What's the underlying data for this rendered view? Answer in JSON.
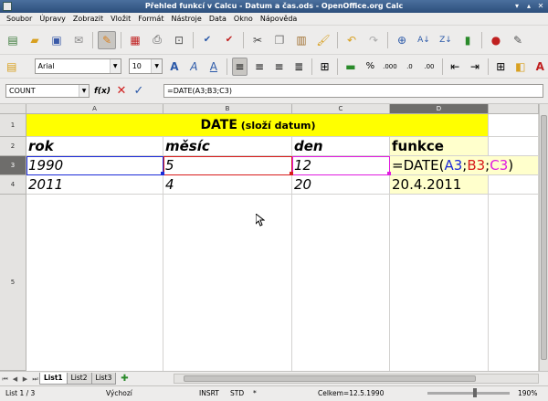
{
  "window": {
    "title": "Přehled funkcí v Calcu - Datum a čas.ods - OpenOffice.org Calc",
    "minimize": "▾",
    "maximize": "▴",
    "close": "✕"
  },
  "menu": [
    "Soubor",
    "Úpravy",
    "Zobrazit",
    "Vložit",
    "Formát",
    "Nástroje",
    "Data",
    "Okno",
    "Nápověda"
  ],
  "toolbar": {
    "font_name": "Arial",
    "font_size": "10"
  },
  "formula_bar": {
    "name_box": "COUNT",
    "fx_label": "f(x)",
    "formula": "=DATE(A3;B3;C3)"
  },
  "columns": [
    {
      "label": "A",
      "selected": false
    },
    {
      "label": "B",
      "selected": false
    },
    {
      "label": "C",
      "selected": false
    },
    {
      "label": "D",
      "selected": true
    }
  ],
  "rows": [
    {
      "label": "1",
      "selected": false
    },
    {
      "label": "2",
      "selected": false
    },
    {
      "label": "3",
      "selected": true
    },
    {
      "label": "4",
      "selected": false
    },
    {
      "label": "5",
      "selected": false
    }
  ],
  "cells": {
    "title_main": "DATE",
    "title_sub": " (složí datum)",
    "header": [
      "rok",
      "měsíc",
      "den",
      "funkce"
    ],
    "row3": [
      "1990",
      "5",
      "12"
    ],
    "row3_formula": {
      "prefix": "=DATE(",
      "ref_a": "A3",
      "sep1": ";",
      "ref_b": "B3",
      "sep2": ";",
      "ref_c": "C3",
      "suffix": ")"
    },
    "row4": [
      "2011",
      "4",
      "20",
      "20.4.2011"
    ]
  },
  "sheet_tabs": [
    {
      "label": "List1",
      "active": true
    },
    {
      "label": "List2",
      "active": false
    },
    {
      "label": "List3",
      "active": false
    }
  ],
  "status": {
    "sheet": "List 1 / 3",
    "style": "Výchozí",
    "insert_mode": "INSRT",
    "selection_mode": "STD",
    "modified": "*",
    "sum": "Celkem=12.5.1990",
    "zoom": "190%"
  },
  "colors": {
    "title_fill": "#ffff00",
    "formula_fill": "#ffffcc",
    "ref_a": "#1c2bd8",
    "ref_b": "#d81c1c",
    "ref_c": "#e01ce0"
  }
}
